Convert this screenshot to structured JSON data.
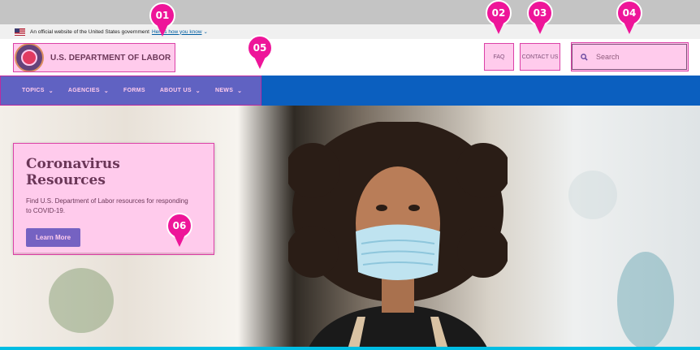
{
  "gov_banner": {
    "text": "An official website of the United States government",
    "link": "Here's how you know"
  },
  "header": {
    "agency_name": "U.S. DEPARTMENT OF LABOR",
    "faq": "FAQ",
    "contact": "CONTACT US",
    "search_placeholder": "Search"
  },
  "nav": {
    "items": [
      {
        "label": "TOPICS",
        "dropdown": true
      },
      {
        "label": "AGENCIES",
        "dropdown": true
      },
      {
        "label": "FORMS",
        "dropdown": false
      },
      {
        "label": "ABOUT US",
        "dropdown": true
      },
      {
        "label": "NEWS",
        "dropdown": true
      }
    ]
  },
  "hero": {
    "title": "Coronavirus Resources",
    "body": "Find U.S. Department of Labor resources for responding to COVID-19.",
    "button": "Learn More"
  },
  "annotations": [
    "01",
    "02",
    "03",
    "04",
    "05",
    "06"
  ],
  "colors": {
    "nav_blue": "#0b5fbf",
    "button_blue": "#2c5fbf",
    "annotation_pink": "#ee1599"
  }
}
